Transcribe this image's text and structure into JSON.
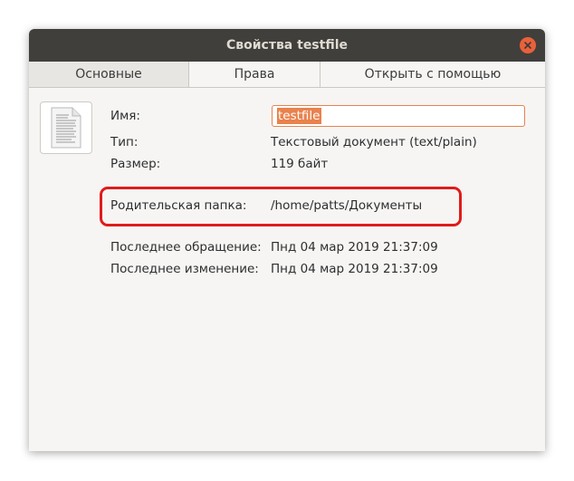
{
  "window": {
    "title": "Свойства testfile"
  },
  "tabs": [
    {
      "label": "Основные",
      "active": true
    },
    {
      "label": "Права",
      "active": false
    },
    {
      "label": "Открыть с помощью",
      "active": false
    }
  ],
  "icons": {
    "file": "text-document-icon",
    "close": "close-icon"
  },
  "properties": {
    "name_label": "Имя:",
    "name_value": "testfile",
    "type_label": "Тип:",
    "type_value": "Текстовый документ (text/plain)",
    "size_label": "Размер:",
    "size_value": "119 байт",
    "parent_label": "Родительская папка:",
    "parent_value": "/home/patts/Документы",
    "accessed_label": "Последнее обращение:",
    "accessed_value": "Пнд 04 мар 2019 21:37:09",
    "modified_label": "Последнее изменение:",
    "modified_value": "Пнд 04 мар 2019 21:37:09"
  },
  "colors": {
    "titlebar": "#403f3c",
    "accent": "#e9824d",
    "highlight": "#e01b1b",
    "close": "#e9613a"
  }
}
